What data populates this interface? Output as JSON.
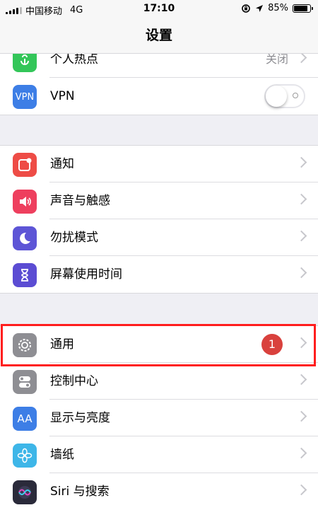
{
  "status_bar": {
    "carrier": "中国移动",
    "network": "4G",
    "time": "17:10",
    "battery": "85%",
    "battery_level": 0.85
  },
  "nav": {
    "title": "设置"
  },
  "group1": [
    {
      "label": "个人热点",
      "value": "关闭",
      "icon": "hotspot-icon",
      "color": "#33c659"
    },
    {
      "label": "VPN",
      "icon_text": "VPN",
      "icon": "vpn-icon",
      "color": "#3d7ee6",
      "toggle": "off"
    }
  ],
  "group2": [
    {
      "label": "通知",
      "icon": "notifications-icon",
      "color": "#ee4c46"
    },
    {
      "label": "声音与触感",
      "icon": "speaker-icon",
      "color": "#ee3f5e"
    },
    {
      "label": "勿扰模式",
      "icon": "moon-icon",
      "color": "#5d55d6"
    },
    {
      "label": "屏幕使用时间",
      "icon": "hourglass-icon",
      "color": "#5b4cd3"
    }
  ],
  "group3": [
    {
      "label": "通用",
      "icon": "gear-icon",
      "color": "#8e8e93",
      "badge": "1"
    },
    {
      "label": "控制中心",
      "icon": "toggles-icon",
      "color": "#8e8e93"
    },
    {
      "label": "显示与亮度",
      "icon_text": "AA",
      "icon": "display-icon",
      "color": "#3d7ee6"
    },
    {
      "label": "墙纸",
      "icon": "flower-icon",
      "color": "#3eb6e8"
    },
    {
      "label": "Siri 与搜索",
      "icon": "siri-icon",
      "color": "#2a2a3a"
    }
  ]
}
